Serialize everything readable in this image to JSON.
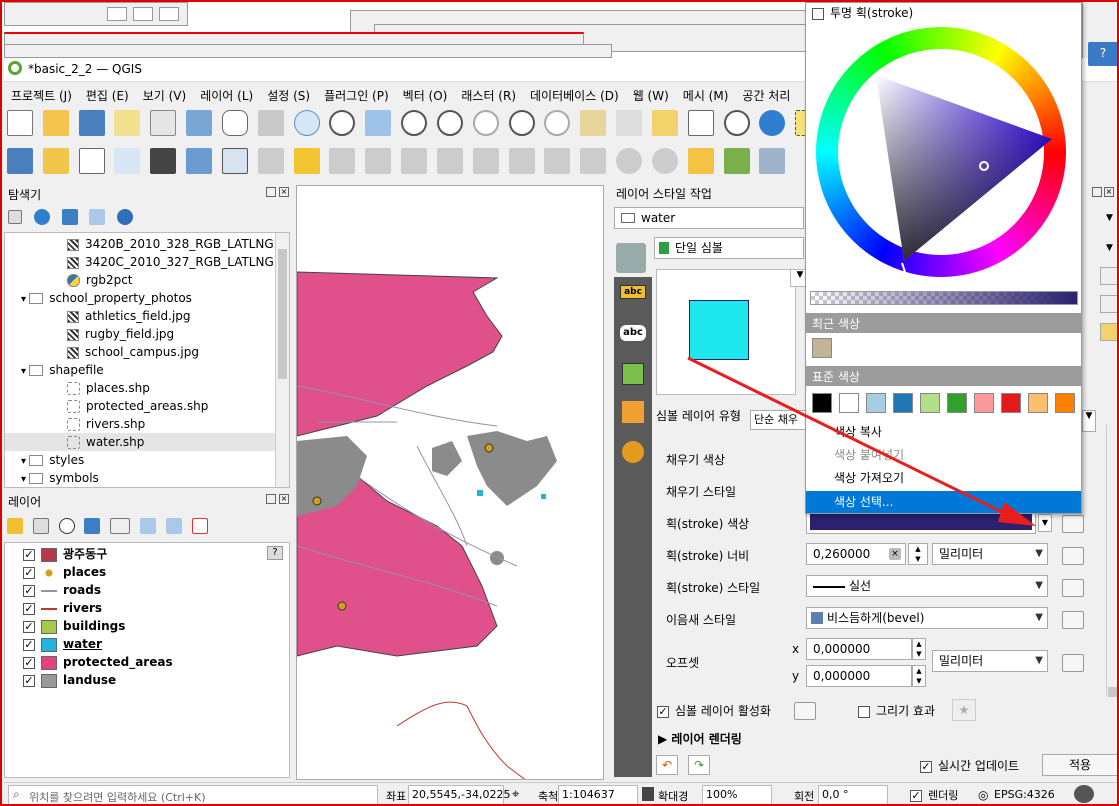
{
  "window": {
    "title": "*basic_2_2 — QGIS"
  },
  "menu": [
    "프로젝트 (J)",
    "편집 (E)",
    "보기 (V)",
    "레이어 (L)",
    "설정 (S)",
    "플러그인 (P)",
    "벡터 (O)",
    "래스터 (R)",
    "데이터베이스 (D)",
    "웹 (W)",
    "메시 (M)",
    "공간 처리"
  ],
  "browser": {
    "title": "탐색기",
    "items": [
      {
        "label": "3420B_2010_328_RGB_LATLNG.tif",
        "type": "raster",
        "indent": 3
      },
      {
        "label": "3420C_2010_327_RGB_LATLNG.tif",
        "type": "raster",
        "indent": 3
      },
      {
        "label": "rgb2pct",
        "type": "python",
        "indent": 3
      },
      {
        "label": "school_property_photos",
        "type": "folder",
        "indent": 2
      },
      {
        "label": "athletics_field.jpg",
        "type": "raster",
        "indent": 3
      },
      {
        "label": "rugby_field.jpg",
        "type": "raster",
        "indent": 3
      },
      {
        "label": "school_campus.jpg",
        "type": "raster",
        "indent": 3
      },
      {
        "label": "shapefile",
        "type": "folder",
        "indent": 2
      },
      {
        "label": "places.shp",
        "type": "shp",
        "indent": 3
      },
      {
        "label": "protected_areas.shp",
        "type": "shp",
        "indent": 3
      },
      {
        "label": "rivers.shp",
        "type": "shp",
        "indent": 3
      },
      {
        "label": "water.shp",
        "type": "shp",
        "indent": 3
      },
      {
        "label": "styles",
        "type": "folder",
        "indent": 2
      },
      {
        "label": "symbols",
        "type": "folder",
        "indent": 2
      }
    ]
  },
  "layers": {
    "title": "레이어",
    "items": [
      {
        "label": "광주동구",
        "color": "#b5394a",
        "kind": "fill"
      },
      {
        "label": "places",
        "color": "#d4a017",
        "kind": "point"
      },
      {
        "label": "roads",
        "color": "#9a8fb5",
        "kind": "line"
      },
      {
        "label": "rivers",
        "color": "#c0392b",
        "kind": "line"
      },
      {
        "label": "buildings",
        "color": "#a6c94a",
        "kind": "fill"
      },
      {
        "label": "water",
        "color": "#1eb5e0",
        "kind": "fill"
      },
      {
        "label": "protected_areas",
        "color": "#e3437c",
        "kind": "fill"
      },
      {
        "label": "landuse",
        "color": "#999999",
        "kind": "fill"
      }
    ]
  },
  "style": {
    "title": "레이어 스타일 작업",
    "layer": "water",
    "renderer": "단일 심볼",
    "symbol_layer_type_label": "심볼 레이어 유형",
    "symbol_layer_type": "단순 채우",
    "fill_color_swatch": "#1ee8ee",
    "props": {
      "fill_color": "채우기 색상",
      "fill_style": "채우기 스타일",
      "stroke_color": "획(stroke) 색상",
      "stroke_width": "획(stroke) 너비",
      "stroke_style": "획(stroke) 스타일",
      "join_style": "이음새 스타일",
      "offset": "오프셋"
    },
    "stroke_color_value": "#2b2170",
    "stroke_width_value": "0,260000",
    "unit": "밀리미터",
    "stroke_style_value": "실선",
    "join_style_value": "비스듬하게(bevel)",
    "offset_x_label": "x",
    "offset_y_label": "y",
    "offset_x": "0,000000",
    "offset_y": "0,000000",
    "enable_layer": "심볼 레이어 활성화",
    "draw_effects": "그리기 효과",
    "layer_render": "레이어 렌더링",
    "live_update": "실시간 업데이트",
    "apply": "적용"
  },
  "picker": {
    "transparent_stroke": "투명 획(stroke)",
    "recent": "최근 색상",
    "recent_color": "#c2b596",
    "standard": "표준 색상",
    "standard_colors": [
      "#000000",
      "#ffffff",
      "#a6cee3",
      "#1f78b4",
      "#b2df8a",
      "#33a02c",
      "#fb9a99",
      "#e31a1c",
      "#fdbf6f",
      "#ff7f00"
    ],
    "copy": "색상 복사",
    "paste": "색상 붙여넣기",
    "import": "색상 가져오기",
    "choose": "색상 선택..."
  },
  "status": {
    "search_placeholder": "위치를 찾으려면 입력하세요 (Ctrl+K)",
    "coord_label": "좌표",
    "coords": "20,5545,-34,0225",
    "scale_label": "축척",
    "scale": "1:104637",
    "magnifier_label": "확대경",
    "magnifier": "100%",
    "rotation_label": "회전",
    "rotation": "0,0 °",
    "render": "렌더링",
    "crs": "EPSG:4326"
  }
}
